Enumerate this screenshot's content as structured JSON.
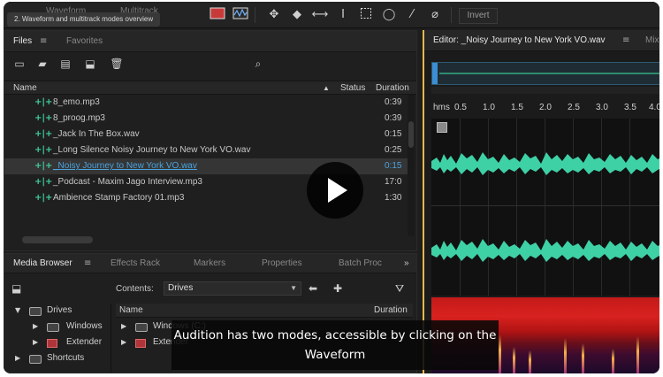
{
  "video": {
    "chip_text": "2. Waveform and multitrack modes overview",
    "caption": "Audition has two modes, accessible by clicking on the Waveform"
  },
  "toolbar": {
    "mode_ghost_1": "Waveform",
    "mode_ghost_2": "Multitrack",
    "invert_label": "Invert",
    "icons": [
      "waveform-view-icon",
      "spectral-view-icon",
      "move-tool-icon",
      "razor-tool-icon",
      "time-selection-icon",
      "text-cursor-icon",
      "marquee-icon",
      "lasso-icon",
      "brush-icon",
      "spot-healing-icon"
    ]
  },
  "files_panel": {
    "tabs": [
      "Files",
      "Favorites"
    ],
    "columns": {
      "name": "Name",
      "status": "Status",
      "duration": "Duration"
    },
    "rows": [
      {
        "name": "8_emo.mp3",
        "duration": "0:39"
      },
      {
        "name": "8_proog.mp3",
        "duration": "0:39"
      },
      {
        "name": "_Jack In The Box.wav",
        "duration": "0:15"
      },
      {
        "name": "_Long Silence Noisy Journey to New York VO.wav",
        "duration": "0:25"
      },
      {
        "name": "_Noisy Journey to New York VO.wav",
        "duration": "0:15",
        "selected": true
      },
      {
        "name": "_Podcast - Maxim Jago Interview.mp3",
        "duration": "17:0"
      },
      {
        "name": "Ambience Stamp Factory 01.mp3",
        "duration": "1:30"
      }
    ]
  },
  "media_browser": {
    "tabs": [
      "Media Browser",
      "Effects Rack",
      "Markers",
      "Properties",
      "Batch Proc"
    ],
    "contents_label": "Contents:",
    "contents_value": "Drives",
    "tree": [
      "Drives",
      "Windows",
      "Extender",
      "Shortcuts"
    ],
    "columns": {
      "name": "Name",
      "duration": "Duration"
    },
    "list": [
      "Windows (C:)",
      "Extender"
    ]
  },
  "editor": {
    "title": "Editor: _Noisy Journey to New York VO.wav",
    "next_tab": "Mix",
    "ruler_unit": "hms",
    "ruler_ticks": [
      "0.5",
      "1.0",
      "1.5",
      "2.0",
      "2.5",
      "3.0",
      "3.5",
      "4.0"
    ],
    "waveform_color": "#3fd1a6"
  }
}
